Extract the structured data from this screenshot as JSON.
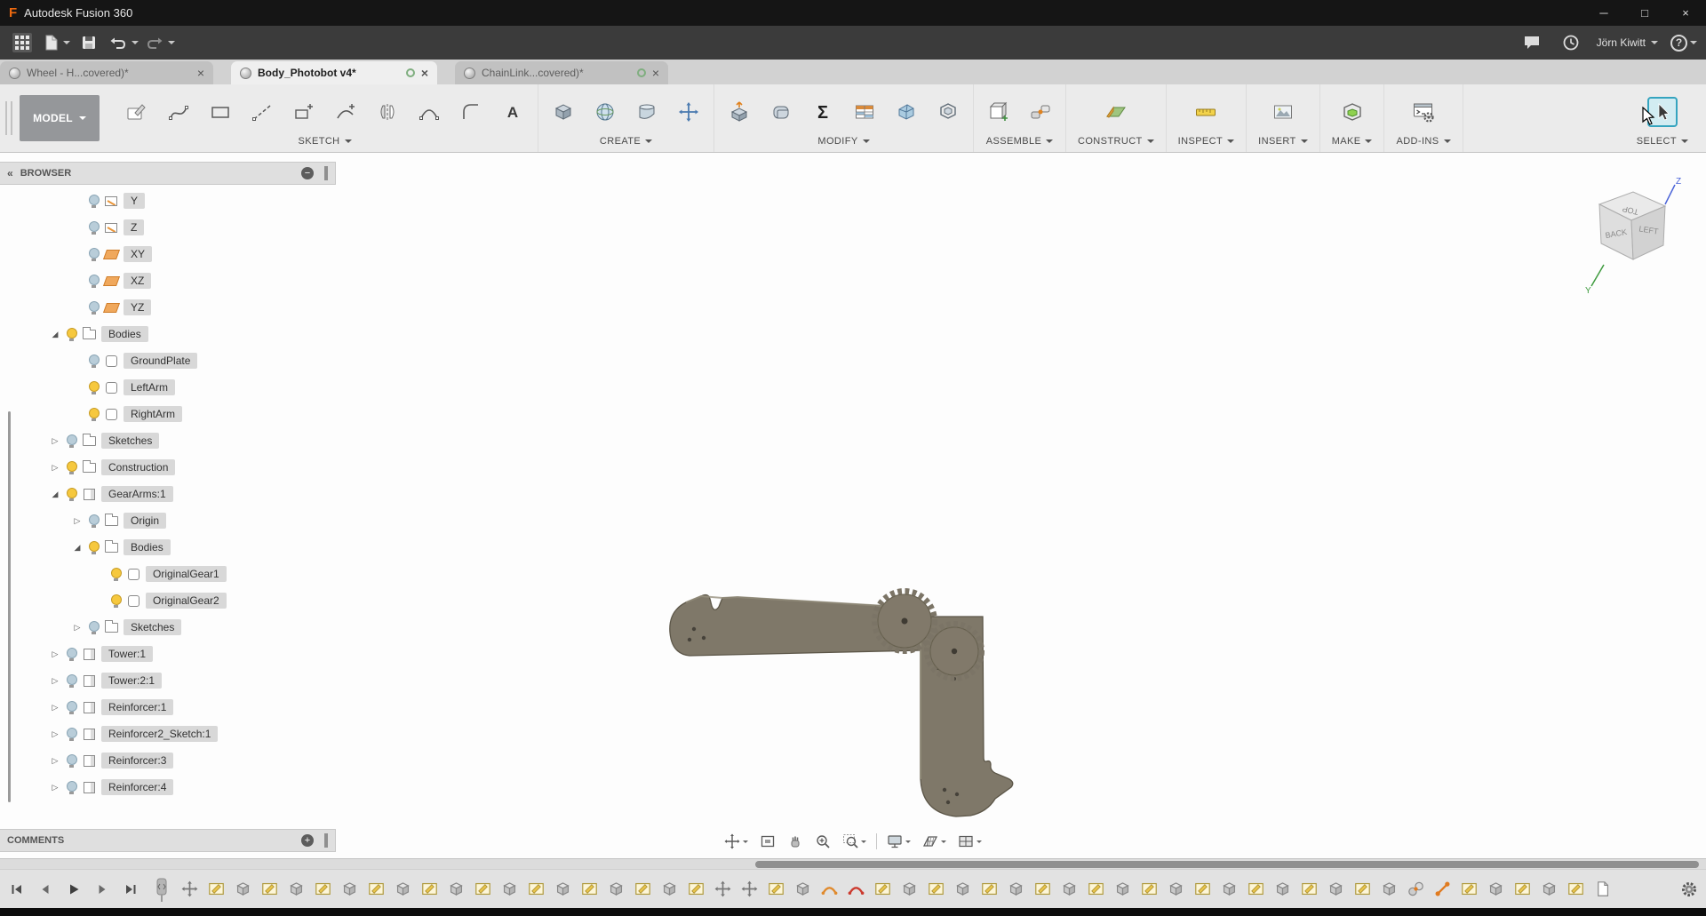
{
  "window": {
    "title": "Autodesk Fusion 360"
  },
  "appbar": {
    "user": "Jörn Kiwitt"
  },
  "tabs": [
    {
      "label": "Wheel - H...covered)*"
    },
    {
      "label": "Body_Photobot v4*"
    },
    {
      "label": "ChainLink...covered)*"
    }
  ],
  "ribbon": {
    "workspace": "MODEL",
    "groups": [
      {
        "label": "SKETCH"
      },
      {
        "label": "CREATE"
      },
      {
        "label": "MODIFY"
      },
      {
        "label": "ASSEMBLE"
      },
      {
        "label": "CONSTRUCT"
      },
      {
        "label": "INSPECT"
      },
      {
        "label": "INSERT"
      },
      {
        "label": "MAKE"
      },
      {
        "label": "ADD-INS"
      },
      {
        "label": "SELECT"
      }
    ]
  },
  "browser": {
    "title": "BROWSER",
    "comments_title": "COMMENTS",
    "items": [
      {
        "label": "Y",
        "indent": 2,
        "bulb": "off",
        "icon": "sketch",
        "expander": "none"
      },
      {
        "label": "Z",
        "indent": 2,
        "bulb": "off",
        "icon": "sketch",
        "expander": "none"
      },
      {
        "label": "XY",
        "indent": 2,
        "bulb": "off",
        "icon": "plane",
        "expander": "none"
      },
      {
        "label": "XZ",
        "indent": 2,
        "bulb": "off",
        "icon": "plane",
        "expander": "none"
      },
      {
        "label": "YZ",
        "indent": 2,
        "bulb": "off",
        "icon": "plane",
        "expander": "none"
      },
      {
        "label": "Bodies",
        "indent": 1,
        "bulb": "on",
        "icon": "folder",
        "expander": "expanded"
      },
      {
        "label": "GroundPlate",
        "indent": 2,
        "bulb": "off",
        "icon": "body",
        "expander": "none"
      },
      {
        "label": "LeftArm",
        "indent": 2,
        "bulb": "on",
        "icon": "body",
        "expander": "none"
      },
      {
        "label": "RightArm",
        "indent": 2,
        "bulb": "on",
        "icon": "body",
        "expander": "none"
      },
      {
        "label": "Sketches",
        "indent": 1,
        "bulb": "off",
        "icon": "folder",
        "expander": "collapsed"
      },
      {
        "label": "Construction",
        "indent": 1,
        "bulb": "on",
        "icon": "folder",
        "expander": "collapsed"
      },
      {
        "label": "GearArms:1",
        "indent": 1,
        "bulb": "on",
        "icon": "component",
        "expander": "expanded"
      },
      {
        "label": "Origin",
        "indent": 2,
        "bulb": "off",
        "icon": "folder",
        "expander": "collapsed"
      },
      {
        "label": "Bodies",
        "indent": 2,
        "bulb": "on",
        "icon": "folder",
        "expander": "expanded"
      },
      {
        "label": "OriginalGear1",
        "indent": 3,
        "bulb": "on",
        "icon": "body",
        "expander": "none"
      },
      {
        "label": "OriginalGear2",
        "indent": 3,
        "bulb": "on",
        "icon": "body",
        "expander": "none"
      },
      {
        "label": "Sketches",
        "indent": 2,
        "bulb": "off",
        "icon": "folder",
        "expander": "collapsed"
      },
      {
        "label": "Tower:1",
        "indent": 1,
        "bulb": "off",
        "icon": "component",
        "expander": "collapsed"
      },
      {
        "label": "Tower:2:1",
        "indent": 1,
        "bulb": "off",
        "icon": "component",
        "expander": "collapsed"
      },
      {
        "label": "Reinforcer:1",
        "indent": 1,
        "bulb": "off",
        "icon": "component",
        "expander": "collapsed"
      },
      {
        "label": "Reinforcer2_Sketch:1",
        "indent": 1,
        "bulb": "off",
        "icon": "component",
        "expander": "collapsed"
      },
      {
        "label": "Reinforcer:3",
        "indent": 1,
        "bulb": "off",
        "icon": "component",
        "expander": "collapsed"
      },
      {
        "label": "Reinforcer:4",
        "indent": 1,
        "bulb": "off",
        "icon": "component",
        "expander": "collapsed"
      }
    ]
  },
  "viewcube": {
    "faces": [
      "TOP",
      "BACK",
      "LEFT"
    ],
    "axes": [
      "Z",
      "Y"
    ]
  },
  "timeline": {
    "items": [
      "move",
      "sketch",
      "extrude",
      "sketch",
      "extrude",
      "sketch",
      "extrude",
      "sketch",
      "extrude",
      "sketch",
      "extrude",
      "sketch",
      "extrude",
      "sketch",
      "extrude",
      "sketch",
      "extrude",
      "sketch",
      "extrude",
      "sketch",
      "move",
      "move",
      "sketch",
      "extrude",
      "arc-orange",
      "arc-red",
      "sketch",
      "extrude",
      "sketch",
      "extrude",
      "sketch",
      "extrude",
      "sketch",
      "extrude",
      "sketch",
      "extrude",
      "sketch",
      "extrude",
      "sketch",
      "extrude",
      "sketch",
      "extrude",
      "sketch",
      "extrude",
      "sketch",
      "extrude",
      "joint",
      "joint-orange",
      "sketch",
      "extrude",
      "sketch",
      "extrude",
      "sketch",
      "paper"
    ]
  },
  "icons": {
    "logo": "F",
    "minimize": "─",
    "maximize": "□",
    "close": "×",
    "collapse_left": "«",
    "minus": "−",
    "plus": "+",
    "expanded": "◢",
    "collapsed": "▷",
    "question": "?",
    "sigma": "Σ",
    "text_tool": "A"
  },
  "colors": {
    "accent_select": "#35a4bf",
    "model_body": "#7f7869",
    "model_edge": "#5c5648",
    "bulb_on": "#f6c83e",
    "bulb_off": "#b9cdd9",
    "plane_icon": "#f0a85c",
    "logo_orange": "#f06a0f"
  }
}
